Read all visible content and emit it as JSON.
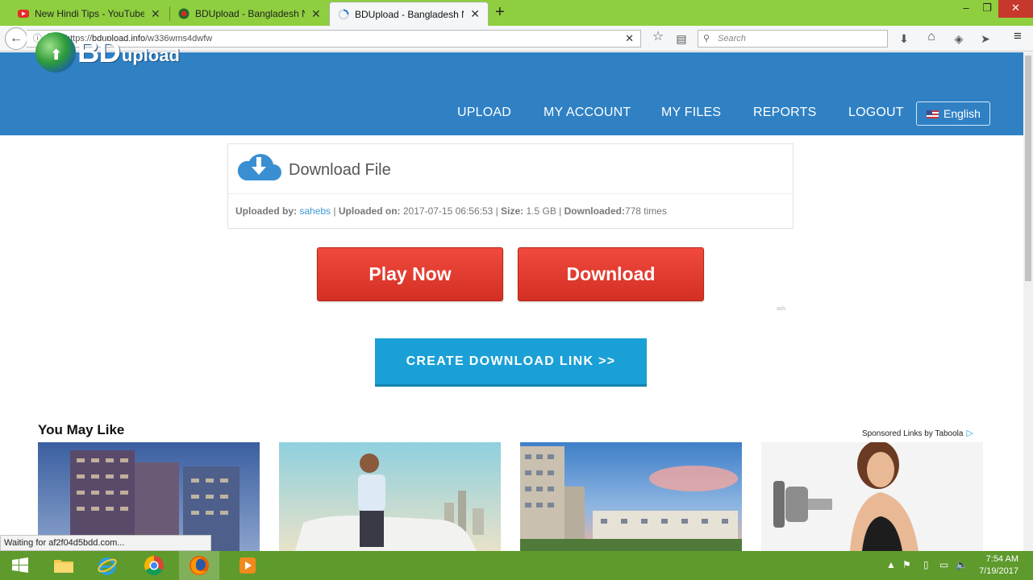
{
  "browser": {
    "tabs": [
      {
        "title": "New Hindi Tips - YouTube",
        "close": "✕"
      },
      {
        "title": "BDUpload - Bangladesh No.",
        "close": "✕"
      },
      {
        "title": "BDUpload - Bangladesh No.",
        "close": "✕"
      }
    ],
    "new_tab": "+",
    "window_controls": {
      "minimize": "–",
      "maximize": "❐",
      "close": "✕"
    },
    "back": "←",
    "info_icon": "ⓘ",
    "lock_icon": "🔒",
    "url_prefix": "https://",
    "url_domain": "bdupload.info",
    "url_path": "/w336wms4dwfw",
    "url_clear": "✕",
    "search_placeholder": "Search",
    "search_icon": "⚲",
    "toolbar_icons": {
      "bookmark": "☆",
      "reader": "▤",
      "downloads": "⬇",
      "home": "⌂",
      "pocket": "◈",
      "share": "➤",
      "menu": "≡"
    }
  },
  "site": {
    "logo_bd": "BD",
    "logo_upload": "upload",
    "logo_arrow": "⬆",
    "menu": [
      "UPLOAD",
      "MY ACCOUNT",
      "MY FILES",
      "REPORTS",
      "LOGOUT"
    ],
    "language": "English",
    "colors": {
      "header": "#2f81c4",
      "red_button": "#e03a2f",
      "blue_button": "#1aa0d6",
      "link": "#3a9ad9"
    }
  },
  "download_panel": {
    "title": "Download File",
    "uploaded_by_label": "Uploaded by:",
    "uploaded_by": "sahebs",
    "sep1": " | ",
    "uploaded_on_label": "Uploaded on:",
    "uploaded_on": "2017-07-15 06:56:53",
    "sep2": " | ",
    "size_label": "Size:",
    "size": "1.5 GB",
    "sep3": " | ",
    "downloaded_label": "Downloaded:",
    "downloaded": "778 times"
  },
  "buttons": {
    "play_now": "Play Now",
    "download": "Download",
    "create_link": "CREATE DOWNLOAD LINK >>"
  },
  "small_mark": "ads",
  "you_may_like": {
    "title": "You May Like",
    "sponsor": "Sponsored Links by Taboola",
    "sponsor_icon": "▷"
  },
  "status_text": "Waiting for af2f04d5bdd.com...",
  "taskbar": {
    "time": "7:54 AM",
    "date": "7/19/2017",
    "tray_icons": [
      "▲",
      "⚑",
      "▯",
      "▭",
      "🔈"
    ]
  }
}
